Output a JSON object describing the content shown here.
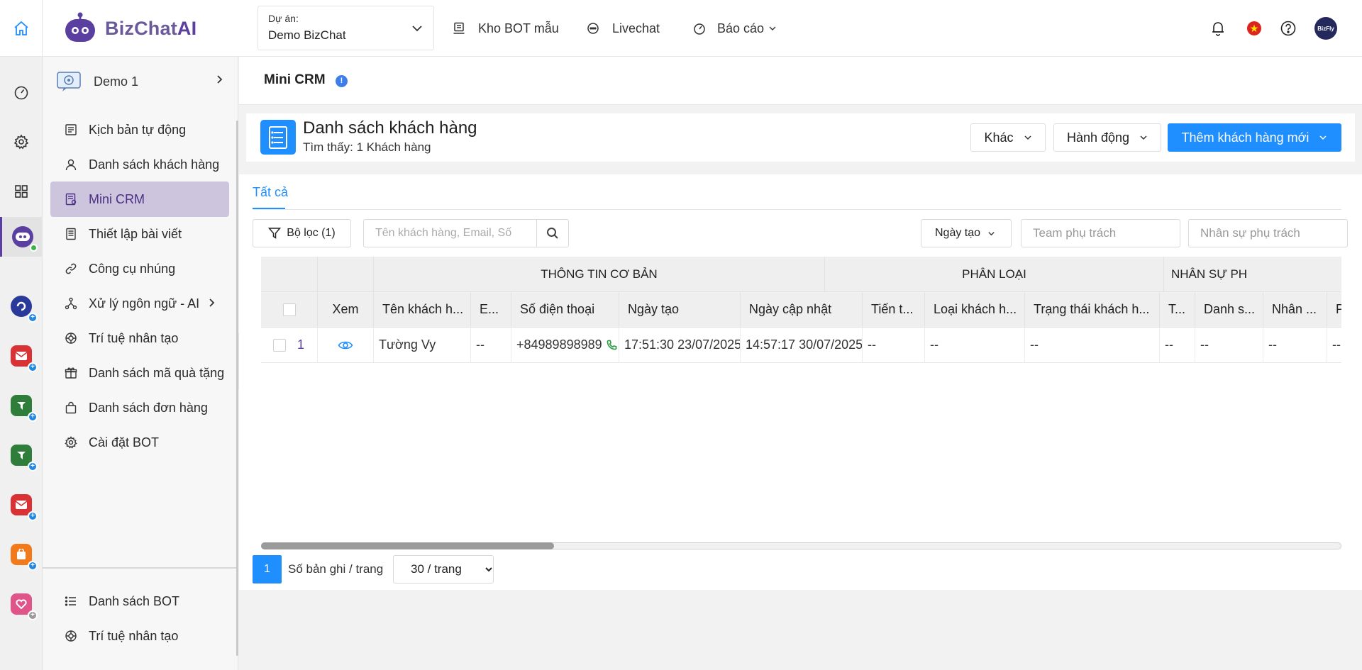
{
  "brand": {
    "name_part1": "BizChat",
    "name_part2": "AI"
  },
  "project": {
    "label": "Dự án:",
    "value": "Demo BizChat"
  },
  "topnav": {
    "templates": "Kho BOT mẫu",
    "livechat": "Livechat",
    "reports": "Báo cáo"
  },
  "bot": {
    "name": "Demo 1"
  },
  "sidebar": {
    "items": [
      {
        "label": "Kịch bản tự động",
        "icon": "script-icon"
      },
      {
        "label": "Danh sách khách hàng",
        "icon": "user-icon"
      },
      {
        "label": "Mini CRM",
        "icon": "crm-icon"
      },
      {
        "label": "Thiết lập bài viết",
        "icon": "post-icon"
      },
      {
        "label": "Công cụ nhúng",
        "icon": "link-icon"
      },
      {
        "label": "Xử lý ngôn ngữ - AI",
        "icon": "nlp-icon"
      },
      {
        "label": "Trí tuệ nhân tạo",
        "icon": "ai-icon"
      },
      {
        "label": "Danh sách mã quà tặng",
        "icon": "gift-icon"
      },
      {
        "label": "Danh sách đơn hàng",
        "icon": "bag-icon"
      },
      {
        "label": "Cài đặt BOT",
        "icon": "gear-icon"
      }
    ],
    "bottom_items": [
      {
        "label": "Danh sách BOT",
        "icon": "list-icon"
      },
      {
        "label": "Trí tuệ nhân tạo",
        "icon": "ai-icon"
      }
    ]
  },
  "page": {
    "title": "Mini CRM"
  },
  "card": {
    "title": "Danh sách khách hàng",
    "subtitle": "Tìm thấy: 1 Khách hàng",
    "btn_other": "Khác",
    "btn_action": "Hành động",
    "btn_add": "Thêm khách hàng mới"
  },
  "tabs": {
    "all": "Tất cả"
  },
  "filters": {
    "filter_btn": "Bộ lọc (1)",
    "search_placeholder": "Tên khách hàng, Email, Số",
    "date_select": "Ngày tạo",
    "team_placeholder": "Team phụ trách",
    "staff_placeholder": "Nhân sự phụ trách"
  },
  "table": {
    "groups": [
      "THÔNG TIN CƠ BẢN",
      "PHÂN LOẠI",
      "NHÂN SỰ PH"
    ],
    "headers": [
      "Xem",
      "Tên khách h...",
      "E...",
      "Số điện thoại",
      "Ngày tạo",
      "Ngày cập nhật",
      "Tiến t...",
      "Loại khách h...",
      "Trạng thái khách h...",
      "T...",
      "Danh s...",
      "Nhân ...",
      "P"
    ],
    "row": {
      "index": "1",
      "name": "Tường Vy",
      "email": "--",
      "phone": "+84989898989",
      "created": "17:51:30 23/07/2025",
      "updated": "14:57:17 30/07/2025",
      "progress": "--",
      "type": "--",
      "status": "--",
      "t": "--",
      "list": "--",
      "staff": "--",
      "p": "--"
    }
  },
  "pagination": {
    "page": "1",
    "per_label": "Số bản ghi / trang",
    "per_value": "30 / trang"
  },
  "colors": {
    "accent": "#1f8fff",
    "brand": "#5b3fa0",
    "active_menu": "#cdc4dd"
  }
}
